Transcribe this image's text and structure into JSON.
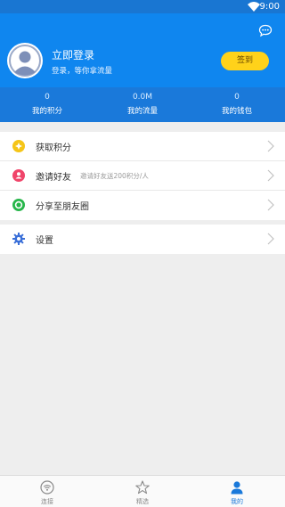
{
  "status_bar": {
    "time": "9:00"
  },
  "profile": {
    "login_title": "立即登录",
    "login_subtitle": "登录，等你拿流量",
    "signin_button": "签到"
  },
  "stats": [
    {
      "value": "0",
      "label": "我的积分"
    },
    {
      "value": "0.0M",
      "label": "我的流量"
    },
    {
      "value": "0",
      "label": "我的钱包"
    }
  ],
  "menu": [
    {
      "label": "获取积分",
      "hint": "",
      "icon": "coin-icon",
      "color": "#f5c518"
    },
    {
      "label": "邀请好友",
      "hint": "邀请好友送200积分/人",
      "icon": "invite-user-icon",
      "color": "#f0456a"
    },
    {
      "label": "分享至朋友圈",
      "hint": "",
      "icon": "moments-icon",
      "color": "#27b64a"
    }
  ],
  "settings": {
    "label": "设置",
    "icon": "gear-icon",
    "color": "#3a6fd8"
  },
  "tabs": [
    {
      "label": "连接",
      "icon": "wifi-icon",
      "active": false
    },
    {
      "label": "精选",
      "icon": "star-icon",
      "active": false
    },
    {
      "label": "我的",
      "icon": "user-icon",
      "active": true
    }
  ],
  "colors": {
    "primary": "#0f86ef",
    "primary_dark": "#1976d2",
    "accent": "#ffd21a"
  }
}
